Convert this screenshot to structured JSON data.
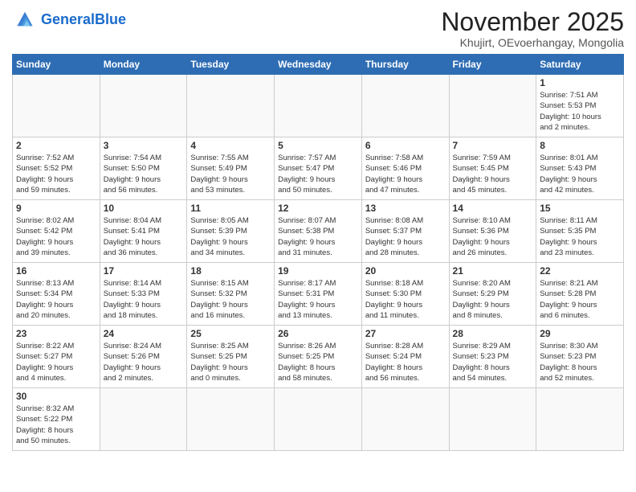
{
  "logo": {
    "general": "General",
    "blue": "Blue"
  },
  "header": {
    "title": "November 2025",
    "subtitle": "Khujirt, OEvoerhangay, Mongolia"
  },
  "weekdays": [
    "Sunday",
    "Monday",
    "Tuesday",
    "Wednesday",
    "Thursday",
    "Friday",
    "Saturday"
  ],
  "weeks": [
    [
      {
        "day": "",
        "info": ""
      },
      {
        "day": "",
        "info": ""
      },
      {
        "day": "",
        "info": ""
      },
      {
        "day": "",
        "info": ""
      },
      {
        "day": "",
        "info": ""
      },
      {
        "day": "",
        "info": ""
      },
      {
        "day": "1",
        "info": "Sunrise: 7:51 AM\nSunset: 5:53 PM\nDaylight: 10 hours\nand 2 minutes."
      }
    ],
    [
      {
        "day": "2",
        "info": "Sunrise: 7:52 AM\nSunset: 5:52 PM\nDaylight: 9 hours\nand 59 minutes."
      },
      {
        "day": "3",
        "info": "Sunrise: 7:54 AM\nSunset: 5:50 PM\nDaylight: 9 hours\nand 56 minutes."
      },
      {
        "day": "4",
        "info": "Sunrise: 7:55 AM\nSunset: 5:49 PM\nDaylight: 9 hours\nand 53 minutes."
      },
      {
        "day": "5",
        "info": "Sunrise: 7:57 AM\nSunset: 5:47 PM\nDaylight: 9 hours\nand 50 minutes."
      },
      {
        "day": "6",
        "info": "Sunrise: 7:58 AM\nSunset: 5:46 PM\nDaylight: 9 hours\nand 47 minutes."
      },
      {
        "day": "7",
        "info": "Sunrise: 7:59 AM\nSunset: 5:45 PM\nDaylight: 9 hours\nand 45 minutes."
      },
      {
        "day": "8",
        "info": "Sunrise: 8:01 AM\nSunset: 5:43 PM\nDaylight: 9 hours\nand 42 minutes."
      }
    ],
    [
      {
        "day": "9",
        "info": "Sunrise: 8:02 AM\nSunset: 5:42 PM\nDaylight: 9 hours\nand 39 minutes."
      },
      {
        "day": "10",
        "info": "Sunrise: 8:04 AM\nSunset: 5:41 PM\nDaylight: 9 hours\nand 36 minutes."
      },
      {
        "day": "11",
        "info": "Sunrise: 8:05 AM\nSunset: 5:39 PM\nDaylight: 9 hours\nand 34 minutes."
      },
      {
        "day": "12",
        "info": "Sunrise: 8:07 AM\nSunset: 5:38 PM\nDaylight: 9 hours\nand 31 minutes."
      },
      {
        "day": "13",
        "info": "Sunrise: 8:08 AM\nSunset: 5:37 PM\nDaylight: 9 hours\nand 28 minutes."
      },
      {
        "day": "14",
        "info": "Sunrise: 8:10 AM\nSunset: 5:36 PM\nDaylight: 9 hours\nand 26 minutes."
      },
      {
        "day": "15",
        "info": "Sunrise: 8:11 AM\nSunset: 5:35 PM\nDaylight: 9 hours\nand 23 minutes."
      }
    ],
    [
      {
        "day": "16",
        "info": "Sunrise: 8:13 AM\nSunset: 5:34 PM\nDaylight: 9 hours\nand 20 minutes."
      },
      {
        "day": "17",
        "info": "Sunrise: 8:14 AM\nSunset: 5:33 PM\nDaylight: 9 hours\nand 18 minutes."
      },
      {
        "day": "18",
        "info": "Sunrise: 8:15 AM\nSunset: 5:32 PM\nDaylight: 9 hours\nand 16 minutes."
      },
      {
        "day": "19",
        "info": "Sunrise: 8:17 AM\nSunset: 5:31 PM\nDaylight: 9 hours\nand 13 minutes."
      },
      {
        "day": "20",
        "info": "Sunrise: 8:18 AM\nSunset: 5:30 PM\nDaylight: 9 hours\nand 11 minutes."
      },
      {
        "day": "21",
        "info": "Sunrise: 8:20 AM\nSunset: 5:29 PM\nDaylight: 9 hours\nand 8 minutes."
      },
      {
        "day": "22",
        "info": "Sunrise: 8:21 AM\nSunset: 5:28 PM\nDaylight: 9 hours\nand 6 minutes."
      }
    ],
    [
      {
        "day": "23",
        "info": "Sunrise: 8:22 AM\nSunset: 5:27 PM\nDaylight: 9 hours\nand 4 minutes."
      },
      {
        "day": "24",
        "info": "Sunrise: 8:24 AM\nSunset: 5:26 PM\nDaylight: 9 hours\nand 2 minutes."
      },
      {
        "day": "25",
        "info": "Sunrise: 8:25 AM\nSunset: 5:25 PM\nDaylight: 9 hours\nand 0 minutes."
      },
      {
        "day": "26",
        "info": "Sunrise: 8:26 AM\nSunset: 5:25 PM\nDaylight: 8 hours\nand 58 minutes."
      },
      {
        "day": "27",
        "info": "Sunrise: 8:28 AM\nSunset: 5:24 PM\nDaylight: 8 hours\nand 56 minutes."
      },
      {
        "day": "28",
        "info": "Sunrise: 8:29 AM\nSunset: 5:23 PM\nDaylight: 8 hours\nand 54 minutes."
      },
      {
        "day": "29",
        "info": "Sunrise: 8:30 AM\nSunset: 5:23 PM\nDaylight: 8 hours\nand 52 minutes."
      }
    ],
    [
      {
        "day": "30",
        "info": "Sunrise: 8:32 AM\nSunset: 5:22 PM\nDaylight: 8 hours\nand 50 minutes."
      },
      {
        "day": "",
        "info": ""
      },
      {
        "day": "",
        "info": ""
      },
      {
        "day": "",
        "info": ""
      },
      {
        "day": "",
        "info": ""
      },
      {
        "day": "",
        "info": ""
      },
      {
        "day": "",
        "info": ""
      }
    ]
  ]
}
